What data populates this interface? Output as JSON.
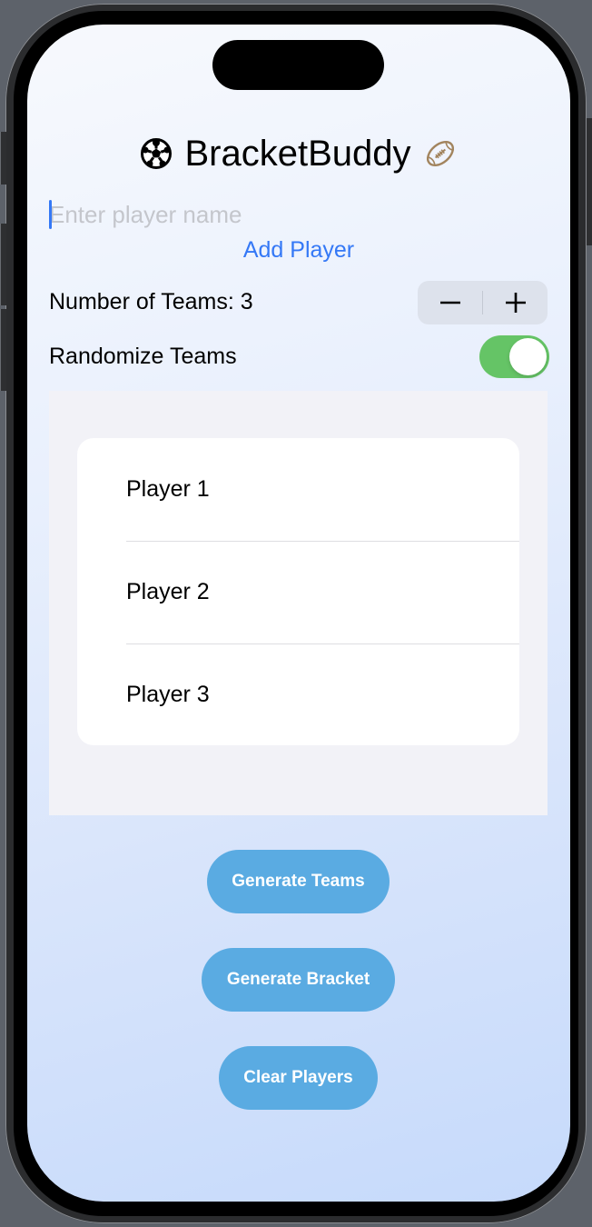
{
  "app": {
    "title": "BracketBuddy",
    "title_left_icon": "soccer-ball-icon",
    "title_right_icon": "american-football-icon"
  },
  "player_input": {
    "value": "",
    "placeholder": "Enter player name"
  },
  "add_player_label": "Add Player",
  "teams": {
    "label": "Number of Teams: 3",
    "count": 3,
    "decrement_icon": "minus-icon",
    "increment_icon": "plus-icon"
  },
  "randomize": {
    "label": "Randomize Teams",
    "on": true
  },
  "players": [
    {
      "name": "Player 1"
    },
    {
      "name": "Player 2"
    },
    {
      "name": "Player 3"
    }
  ],
  "actions": {
    "generate_teams": "Generate Teams",
    "generate_bracket": "Generate Bracket",
    "clear_players": "Clear Players"
  },
  "colors": {
    "accent": "#3478f6",
    "toggle_on": "#65c466",
    "action_button": "#5aabe2",
    "football": "#a2845e"
  }
}
